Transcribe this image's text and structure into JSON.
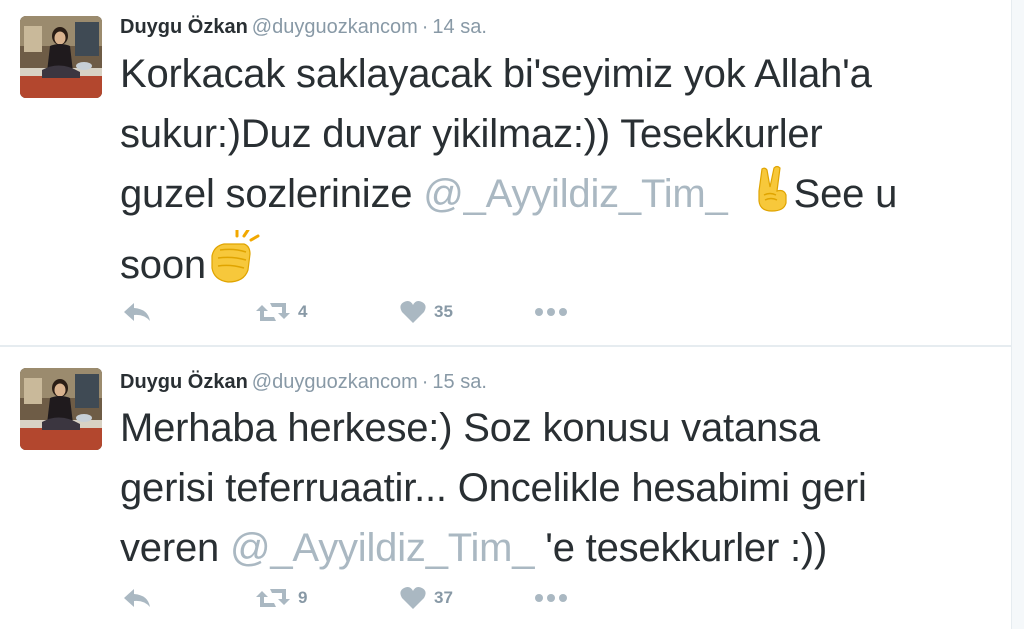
{
  "tweets": [
    {
      "author": {
        "fullname": "Duygu Özkan",
        "username": "@duyguozkancom"
      },
      "separator": "·",
      "time": "14 sa.",
      "text": {
        "line1": "Korkacak saklayacak  bi'seyimiz yok Allah'a",
        "line2": "sukur:)Duz duvar yikilmaz:)) Tesekkurler",
        "line3_before": "guzel sozlerinize ",
        "mention": "@_Ayyildiz_Tim_",
        "line3_emoji": "✌️",
        "line3_after": "See u",
        "line4": "soon",
        "line4_emoji": "👏"
      },
      "actions": {
        "reply_icon": "reply-icon",
        "retweet_icon": "retweet-icon",
        "retweet_count": "4",
        "like_icon": "heart-icon",
        "like_count": "35",
        "more_icon": "more-dots-icon"
      }
    },
    {
      "author": {
        "fullname": "Duygu Özkan",
        "username": "@duyguozkancom"
      },
      "separator": "·",
      "time": "15 sa.",
      "text": {
        "line1": "Merhaba herkese:) Soz konusu vatansa",
        "line2": "gerisi teferruaatir... Oncelikle hesabimi geri",
        "line3_before": "veren ",
        "mention": "@_Ayyildiz_Tim_",
        "line3_after": " 'e tesekkurler :))"
      },
      "actions": {
        "reply_icon": "reply-icon",
        "retweet_icon": "retweet-icon",
        "retweet_count": "9",
        "like_icon": "heart-icon",
        "like_count": "37",
        "more_icon": "more-dots-icon"
      }
    }
  ],
  "colors": {
    "text": "#292f33",
    "muted": "#8899a6",
    "mention": "#aab8c2",
    "divider": "#e6ecf0"
  }
}
